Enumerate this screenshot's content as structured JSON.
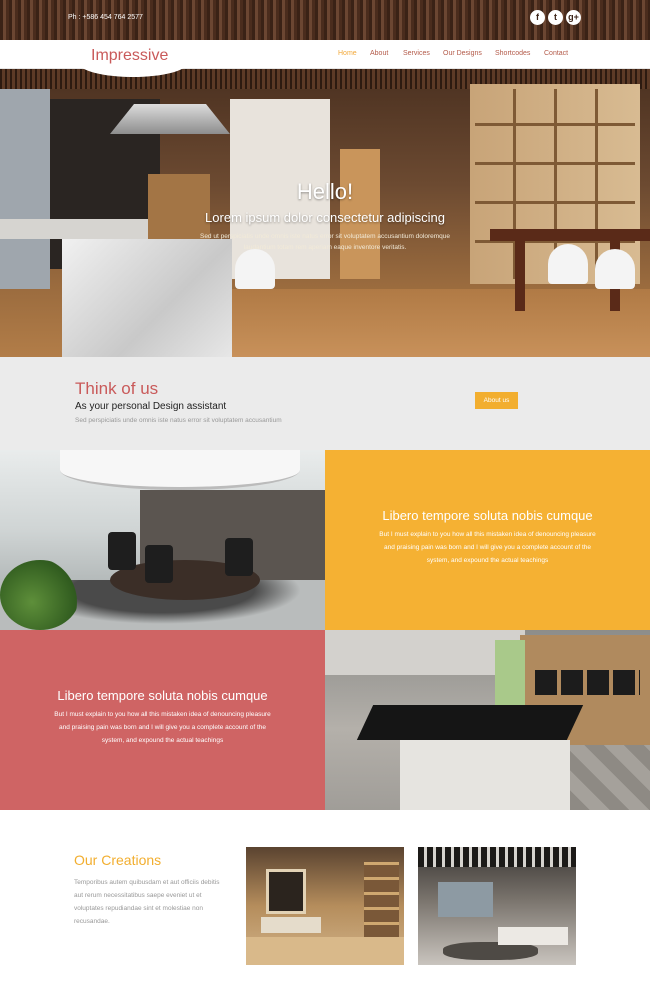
{
  "topbar": {
    "phone": "Ph : +586 454 764 2577",
    "social": [
      {
        "icon": "facebook-icon",
        "glyph": "f"
      },
      {
        "icon": "twitter-icon",
        "glyph": "t"
      },
      {
        "icon": "google-plus-icon",
        "glyph": "g+"
      }
    ]
  },
  "nav": {
    "logo": "Impressive",
    "items": [
      "Home",
      "About",
      "Services",
      "Our Designs",
      "Shortcodes",
      "Contact"
    ],
    "active": "Home"
  },
  "hero": {
    "title": "Hello!",
    "subtitle": "Lorem ipsum dolor consectetur adipiscing",
    "text": "Sed ut perspiciatis unde omnis iste natus error sit voluptatem accusantium doloremque laudantium totam rem aperiam eaque inventore veritatis."
  },
  "think": {
    "title": "Think of us",
    "subtitle": "As your personal Design assistant",
    "text": "Sed perspiciatis unde omnis iste natus error sit voluptatem accusantium",
    "button": "About us"
  },
  "features": [
    {
      "title": "Libero tempore soluta nobis cumque",
      "text": "But I must explain to you how all this mistaken idea of denouncing pleasure and praising pain was born and I will give you a complete account of the system, and expound the actual teachings"
    },
    {
      "title": "Libero tempore soluta nobis cumque",
      "text": "But I must explain to you how all this mistaken idea of denouncing pleasure and praising pain was born and I will give you a complete account of the system, and expound the actual teachings"
    }
  ],
  "creations": {
    "title": "Our Creations",
    "text": "Temporibus autem quibusdam et aut officiis debitis aut rerum necessitatibus saepe eveniet ut et voluptates repudiandae sint et molestiae non recusandae."
  },
  "colors": {
    "accent_orange": "#f5b133",
    "accent_red": "#cf6464",
    "logo_red": "#c95a5a"
  }
}
